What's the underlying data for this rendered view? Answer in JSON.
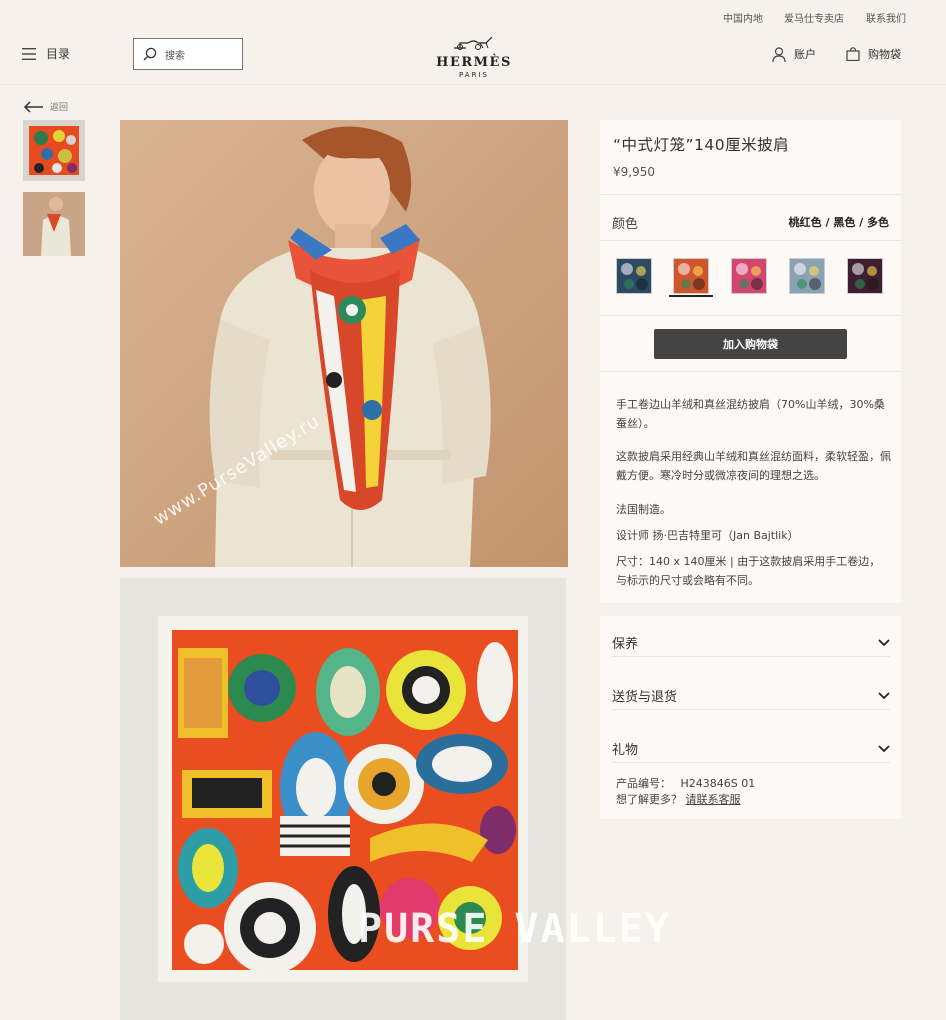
{
  "utility_nav": {
    "region": "中国内地",
    "store": "爱马仕专卖店",
    "contact": "联系我们"
  },
  "header": {
    "menu_label": "目录",
    "search_placeholder": "搜索",
    "logo_brand": "HERMÈS",
    "logo_city": "PARIS",
    "account_label": "账户",
    "cart_label": "购物袋"
  },
  "back_label": "返回",
  "watermarks": {
    "photo": "www.PurseValley.ru",
    "scarf": "PURSE VALLEY"
  },
  "product": {
    "title": "“中式灯笼”140厘米披肩",
    "price": "¥9,950",
    "color_label": "颜色",
    "color_names": "桃红色 / 黑色 / 多色",
    "swatches": [
      {
        "color": "#2d4a63",
        "selected": false
      },
      {
        "color": "#d0562c",
        "selected": true
      },
      {
        "color": "#d2466f",
        "selected": false
      },
      {
        "color": "#8aa2b4",
        "selected": false
      },
      {
        "color": "#3e1f2f",
        "selected": false
      }
    ],
    "add_to_cart": "加入购物袋",
    "description": [
      "手工卷边山羊绒和真丝混纺披肩（70%山羊绒，30%桑蚕丝）。",
      "这款披肩采用经典山羊绒和真丝混纺面料，柔软轻盈，佩戴方便。寒冷时分或微凉夜间的理想之选。",
      "法国制造。",
      "设计师 扬·巴吉特里可（Jan Bajtlik）",
      "尺寸：140 x 140厘米 | 由于这款披肩采用手工卷边，与标示的尺寸或会略有不同。"
    ]
  },
  "accordion": {
    "care": "保养",
    "delivery": "送货与退货",
    "gift": "礼物"
  },
  "product_ref": {
    "label": "产品编号：",
    "value": "H243846S 01",
    "question": "想了解更多？",
    "link": "请联系客服"
  }
}
